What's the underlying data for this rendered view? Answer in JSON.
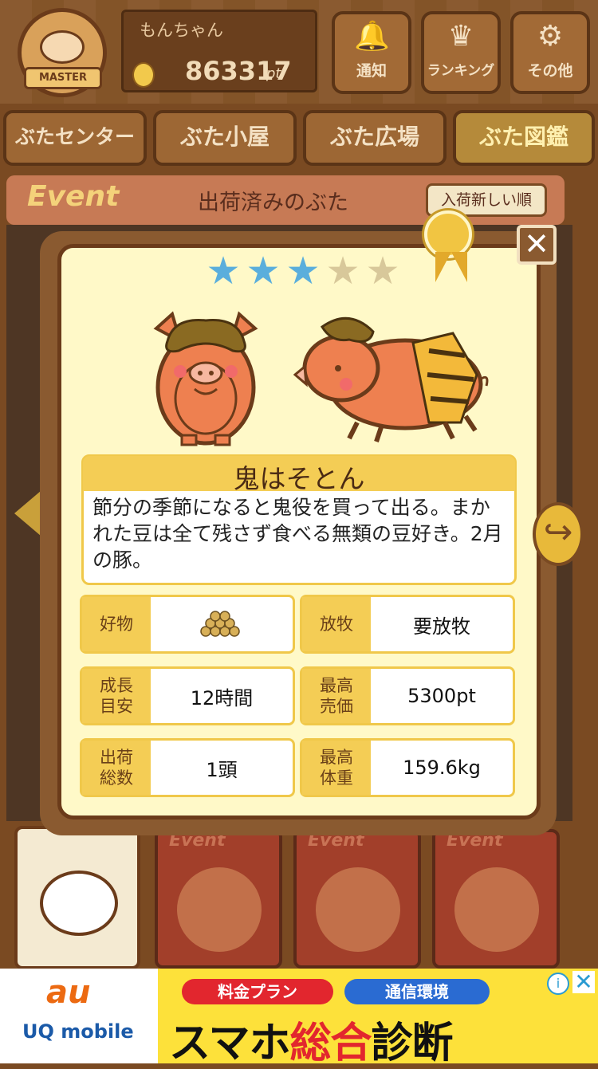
{
  "header": {
    "badge_text": "MASTER",
    "username": "もんちゃん",
    "points": "863317",
    "points_unit": "pt",
    "buttons": [
      {
        "label": "通知",
        "icon": "bell-icon"
      },
      {
        "label": "ランキング",
        "icon": "crown-icon"
      },
      {
        "label": "その他",
        "icon": "gear-icon"
      }
    ]
  },
  "nav": {
    "tabs": [
      "ぶたセンター",
      "ぶた小屋",
      "ぶた広場",
      "ぶた図鑑"
    ],
    "active_index": 3
  },
  "event_bar": {
    "logo": "Event",
    "title": "出荷済みのぶた",
    "sort_label": "入荷新しい順"
  },
  "modal": {
    "rating": 3,
    "rating_max": 5,
    "name": "鬼はそとん",
    "description": "節分の季節になると鬼役を買って出る。まかれた豆は全て残さず食べる無類の豆好き。2月の豚。",
    "close_symbol": "✕",
    "stats": [
      {
        "label": "好物",
        "value": "",
        "icon": "soybeans-icon"
      },
      {
        "label": "放牧",
        "value": "要放牧"
      },
      {
        "label": "成長\n目安",
        "value": "12時間"
      },
      {
        "label": "最高\n売価",
        "value": "5300pt"
      },
      {
        "label": "出荷\n総数",
        "value": "1頭"
      },
      {
        "label": "最高\n体重",
        "value": "159.6kg"
      }
    ]
  },
  "bottom_cards": {
    "event_label": "Event"
  },
  "ad": {
    "brand1": "au",
    "brand2": "UQ mobile",
    "pill1": "料金プラン",
    "pill2": "通信環境",
    "headline_a": "スマホ",
    "headline_b": "総合",
    "headline_c": "診断",
    "info_symbol": "i",
    "close_symbol": "✕"
  },
  "colors": {
    "star_on": "#5aaedc",
    "star_off": "#d8c89a",
    "accent_yellow": "#f4cd55",
    "wood": "#8a5a30"
  }
}
